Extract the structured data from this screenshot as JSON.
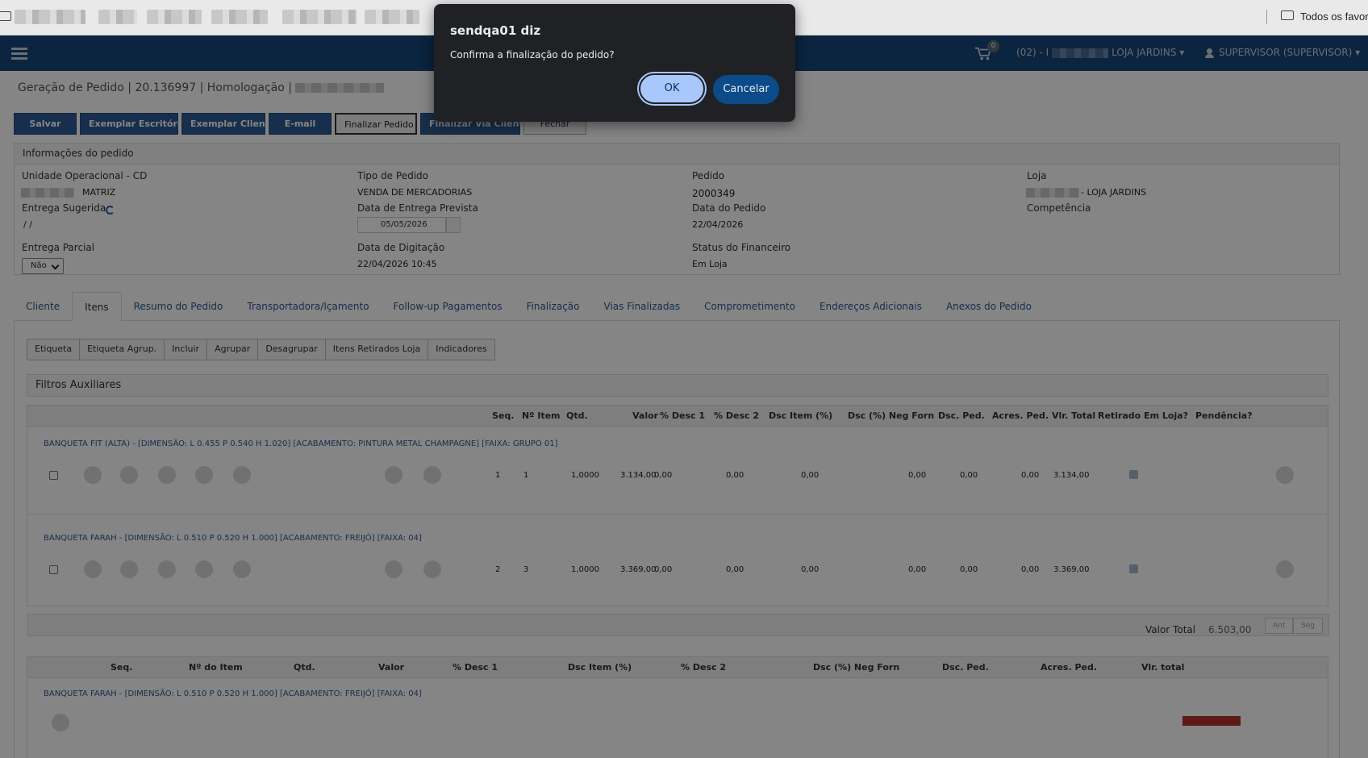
{
  "browser": {
    "favorites_label": "Todos os favoritos"
  },
  "header": {
    "cart_count": "0",
    "store_prefix": "(02) - I",
    "store_name": "LOJA JARDINS",
    "user": "SUPERVISOR (SUPERVISOR)"
  },
  "breadcrumb": "Geração de Pedido | 20.136997 | Homologação |",
  "toolbar": {
    "salvar": "Salvar",
    "exemplar_escritorio": "Exemplar Escritório",
    "exemplar_cliente": "Exemplar Cliente",
    "email": "E-mail",
    "finalizar_pedido": "Finalizar Pedido",
    "finalizar_via_cliente": "Finalizar Via Cliente",
    "fechar": "Fechar"
  },
  "info": {
    "title": "Informações do pedido",
    "unidade_label": "Unidade Operacional - CD",
    "unidade_value": "MATRIZ",
    "tipo_label": "Tipo de Pedido",
    "tipo_value": "VENDA DE MERCADORIAS",
    "pedido_label": "Pedido",
    "pedido_value": "2000349",
    "loja_label": "Loja",
    "loja_value": "- LOJA JARDINS",
    "entrega_sugerida_label": "Entrega Sugerida",
    "entrega_sugerida_value": "/ /",
    "data_entrega_label": "Data de Entrega Prevista",
    "data_entrega_value": "05/05/2026",
    "data_pedido_label": "Data do Pedido",
    "data_pedido_value": "22/04/2026",
    "competencia_label": "Competência",
    "entrega_parcial_label": "Entrega Parcial",
    "entrega_parcial_value": "Não",
    "data_digitacao_label": "Data de Digitação",
    "data_digitacao_value": "22/04/2026 10:45",
    "status_fin_label": "Status do Financeiro",
    "status_fin_value": "Em Loja"
  },
  "tabs": [
    "Cliente",
    "Itens",
    "Resumo do Pedido",
    "Transportadora/Içamento",
    "Follow-up Pagamentos",
    "Finalização",
    "Vias Finalizadas",
    "Comprometimento",
    "Endereços Adicionais",
    "Anexos do Pedido"
  ],
  "sub_toolbar": [
    "Etiqueta",
    "Etiqueta Agrup.",
    "Incluir",
    "Agrupar",
    "Desagrupar",
    "Itens Retirados Loja",
    "Indicadores"
  ],
  "filters_label": "Filtros Auxiliares",
  "grid": {
    "headers": [
      "Seq.",
      "Nº Item",
      "Qtd.",
      "Valor",
      "% Desc 1",
      "% Desc 2",
      "Dsc Item (%)",
      "Dsc (%) Neg Forn",
      "Dsc. Ped.",
      "Acres. Ped.",
      "Vlr. Total",
      "Retirado Em Loja?",
      "Pendência?"
    ],
    "rows": [
      {
        "product": "BANQUETA FIT (ALTA) - [DIMENSÃO: L 0.455 P 0.540 H 1.020] [ACABAMENTO: PINTURA METAL CHAMPAGNE] [FAIXA: GRUPO 01]",
        "seq": "1",
        "item": "1",
        "qtd": "1,0000",
        "valor": "3.134,00",
        "desc1": "0,00",
        "desc2": "0,00",
        "dsc_item": "0,00",
        "neg_forn": "0,00",
        "dsc_ped": "0,00",
        "acres": "0,00",
        "total": "3.134,00"
      },
      {
        "product": "BANQUETA FARAH - [DIMENSÃO: L 0.510 P 0.520 H 1.000] [ACABAMENTO: FREIJÓ] [FAIXA: 04]",
        "seq": "2",
        "item": "3",
        "qtd": "1,0000",
        "valor": "3.369,00",
        "desc1": "0,00",
        "desc2": "0,00",
        "dsc_item": "0,00",
        "neg_forn": "0,00",
        "dsc_ped": "0,00",
        "acres": "0,00",
        "total": "3.369,00"
      }
    ],
    "pager_prev": "Ant",
    "pager_next": "Seg",
    "valor_total_label": "Valor Total",
    "valor_total_value": "6.503,00"
  },
  "grid2": {
    "headers": [
      "Seq.",
      "Nº do Item",
      "Qtd.",
      "Valor",
      "% Desc 1",
      "Dsc Item (%)",
      "% Desc 2",
      "Dsc (%) Neg Forn",
      "Dsc. Ped.",
      "Acres. Ped.",
      "Vlr. total"
    ],
    "product": "BANQUETA FARAH - [DIMENSÃO: L 0.510 P 0.520 H 1.000] [ACABAMENTO: FREIJÓ] [FAIXA: 04]"
  },
  "dialog": {
    "title": "sendqa01 diz",
    "message": "Confirma a finalização do pedido?",
    "ok": "OK",
    "cancel": "Cancelar"
  }
}
